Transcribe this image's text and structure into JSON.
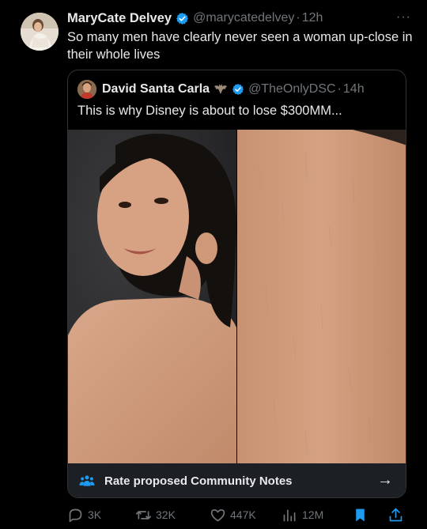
{
  "tweet": {
    "author_name": "MaryCate Delvey",
    "handle": "@marycatedelvey",
    "separator": "·",
    "time": "12h",
    "more": "···",
    "text": "So many men have clearly never seen a woman up-close in their whole lives"
  },
  "quote": {
    "author_name": "David Santa Carla",
    "handle": "@TheOnlyDSC",
    "separator": "·",
    "time": "14h",
    "text": "This is why Disney is about to lose $300MM..."
  },
  "community_notes": {
    "label": "Rate proposed Community Notes",
    "arrow": "→"
  },
  "actions": {
    "replies": "3K",
    "reposts": "32K",
    "likes": "447K",
    "views": "12M"
  },
  "colors": {
    "background": "#000000",
    "text": "#e7e9ea",
    "muted": "#71767b",
    "verified": "#1d9bf0",
    "border": "#2f3336",
    "notes_bar": "#1c1f23"
  },
  "icons": [
    "verified-badge-icon",
    "more-icon",
    "bat-icon",
    "people-icon",
    "arrow-right-icon",
    "reply-icon",
    "repost-icon",
    "like-icon",
    "views-icon",
    "bookmark-icon",
    "share-icon"
  ]
}
